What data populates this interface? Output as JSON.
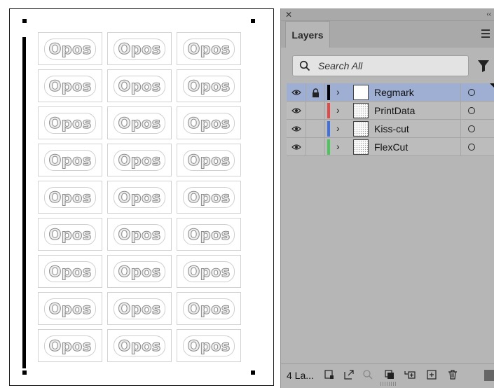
{
  "artboard": {
    "sticker_label": "Opos",
    "sticker_count": 27,
    "columns": 3
  },
  "panel": {
    "tab_label": "Layers",
    "search": {
      "placeholder": "Search All",
      "value": ""
    },
    "layers": [
      {
        "name": "Regmark",
        "color": "#000000",
        "selected": true,
        "locked": true,
        "visible": true,
        "thumb": "blank"
      },
      {
        "name": "PrintData",
        "color": "#e24a4a",
        "selected": false,
        "locked": false,
        "visible": true,
        "thumb": "dots"
      },
      {
        "name": "Kiss-cut",
        "color": "#3f72e0",
        "selected": false,
        "locked": false,
        "visible": true,
        "thumb": "dots"
      },
      {
        "name": "FlexCut",
        "color": "#4cc65a",
        "selected": false,
        "locked": false,
        "visible": true,
        "thumb": "dots"
      }
    ],
    "footer": {
      "layer_count": "4 La..."
    }
  }
}
